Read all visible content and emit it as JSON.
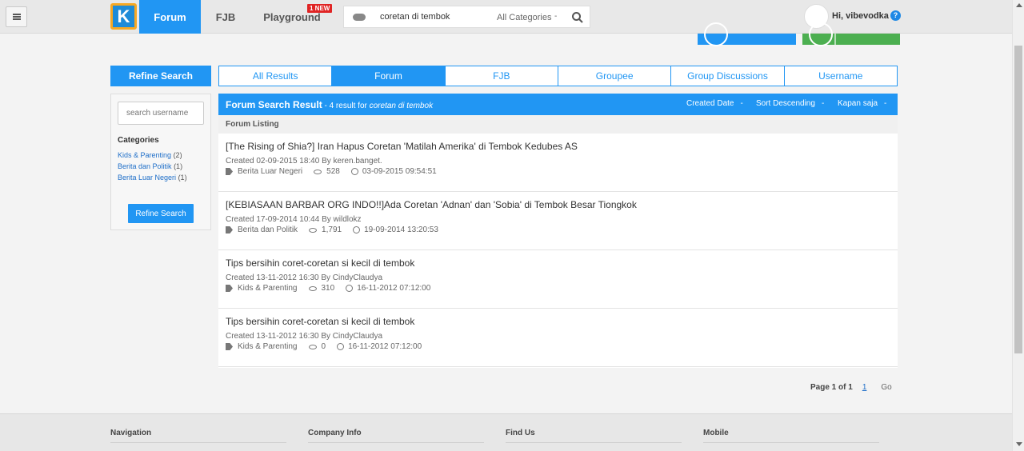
{
  "topbar": {
    "nav_forum": "Forum",
    "nav_fjb": "FJB",
    "nav_playground": "Playground",
    "new_badge": "1 NEW",
    "search_value": "coretan di tembok",
    "search_category": "All Categories",
    "caret": "-",
    "greeting": "Hi, vibevodka",
    "help": "?"
  },
  "sidebar": {
    "header": "Refine Search",
    "username_placeholder": "search username",
    "categories_title": "Categories",
    "categories": [
      {
        "name": "Kids & Parenting",
        "count": "(2)"
      },
      {
        "name": "Berita dan Politik",
        "count": "(1)"
      },
      {
        "name": "Berita Luar Negeri",
        "count": "(1)"
      }
    ],
    "button": "Refine Search"
  },
  "tabs": [
    "All Results",
    "Forum",
    "FJB",
    "Groupee",
    "Group Discussions",
    "Username"
  ],
  "results": {
    "title": "Forum Search Result",
    "subtitle_prefix": " - 4 result for ",
    "query": "coretan di tembok",
    "opt_date": "Created Date",
    "opt_sort": "Sort Descending",
    "opt_time": "Kapan saja",
    "dash": "-",
    "listing_label": "Forum Listing",
    "items": [
      {
        "title": "[The Rising of Shia?] Iran Hapus Coretan 'Matilah Amerika' di Tembok Kedubes AS",
        "created": "Created 02-09-2015 18:40 By keren.banget.",
        "category": "Berita Luar Negeri",
        "views": "528",
        "updated": "03-09-2015 09:54:51"
      },
      {
        "title": "[KEBIASAAN BARBAR ORG INDO!!]Ada Coretan 'Adnan' dan 'Sobia' di Tembok Besar Tiongkok",
        "created": "Created 17-09-2014 10:44 By wildlokz",
        "category": "Berita dan Politik",
        "views": "1,791",
        "updated": "19-09-2014 13:20:53"
      },
      {
        "title": "Tips bersihin coret-coretan si kecil di tembok",
        "created": "Created 13-11-2012 16:30 By CindyClaudya",
        "category": "Kids & Parenting",
        "views": "310",
        "updated": "16-11-2012 07:12:00"
      },
      {
        "title": "Tips bersihin coret-coretan si kecil di tembok",
        "created": "Created 13-11-2012 16:30 By CindyClaudya",
        "category": "Kids & Parenting",
        "views": "0",
        "updated": "16-11-2012 07:12:00"
      }
    ]
  },
  "pagination": {
    "text": "Page 1 of 1",
    "page": "1",
    "go": "Go"
  },
  "footer": {
    "navigation": "Navigation",
    "company": "Company Info",
    "find_us": "Find Us",
    "mobile": "Mobile"
  },
  "colors": {
    "accent": "#2196f3",
    "logo_border": "#f7a823",
    "badge": "#e02424",
    "green": "#4caf50"
  }
}
